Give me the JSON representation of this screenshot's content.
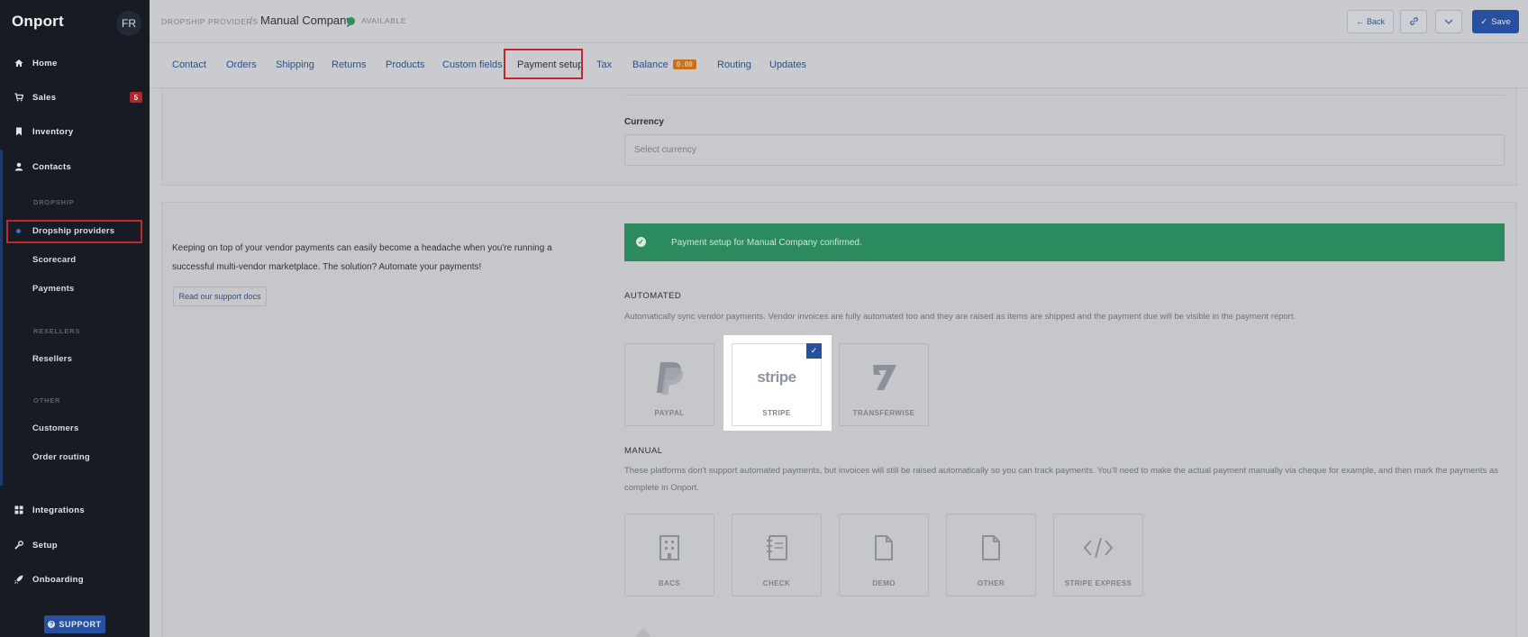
{
  "sidebar": {
    "logo": "Onport",
    "avatar": "FR",
    "nav": [
      {
        "label": "Home",
        "icon": "home-icon"
      },
      {
        "label": "Sales",
        "icon": "cart-icon",
        "badge": "5"
      },
      {
        "label": "Inventory",
        "icon": "bookmark-icon"
      },
      {
        "label": "Contacts",
        "icon": "user-icon"
      }
    ],
    "dropship_head": "DROPSHIP",
    "dropship_items": [
      "Dropship providers",
      "Scorecard",
      "Payments"
    ],
    "resellers_head": "RESELLERS",
    "resellers_items": [
      "Resellers"
    ],
    "other_head": "OTHER",
    "other_items": [
      "Customers",
      "Order routing"
    ],
    "bottom_nav": [
      {
        "label": "Integrations",
        "icon": "grid-icon"
      },
      {
        "label": "Setup",
        "icon": "wrench-icon"
      },
      {
        "label": "Onboarding",
        "icon": "rocket-icon"
      }
    ],
    "support": "SUPPORT"
  },
  "header": {
    "breadcrumb": "DROPSHIP PROVIDERS",
    "separator": "/",
    "title": "Manual Company",
    "status": "AVAILABLE",
    "status_color": "#2f8f5b",
    "back": "Back",
    "save": "Save"
  },
  "tabs": [
    "Contact",
    "Orders",
    "Shipping",
    "Returns",
    "Products",
    "Custom fields",
    "Payment setup",
    "Tax",
    "Balance",
    "Routing",
    "Updates"
  ],
  "balance_badge": "0.00",
  "currency": {
    "label": "Currency",
    "placeholder": "Select currency"
  },
  "payments": {
    "intro": "Keeping on top of your vendor payments can easily become a headache when you're running a successful multi-vendor marketplace. The solution? Automate your payments!",
    "docs_button": "Read our support docs",
    "alert": "Payment setup for Manual Company confirmed.",
    "alert_color": "#2b8a5e",
    "automated_title": "AUTOMATED",
    "automated_desc": "Automatically sync vendor payments. Vendor invoices are fully automated too and they are raised as items are shipped and the payment due will be visible in the payment report.",
    "automated": [
      {
        "label": "PAYPAL",
        "icon": "paypal-icon"
      },
      {
        "label": "STRIPE",
        "icon": "stripe-logo",
        "logo_text": "stripe",
        "selected": true
      },
      {
        "label": "TRANSFERWISE",
        "icon": "transferwise-icon"
      }
    ],
    "manual_title": "MANUAL",
    "manual_desc": "These platforms don't support automated payments, but invoices will still be raised automatically so you can track payments. You'll need to make the actual payment manually via cheque for example, and then mark the payments as complete in Onport.",
    "manual": [
      {
        "label": "BACS",
        "icon": "building-icon"
      },
      {
        "label": "CHECK",
        "icon": "notebook-icon"
      },
      {
        "label": "DEMO",
        "icon": "file-icon"
      },
      {
        "label": "OTHER",
        "icon": "file-icon"
      },
      {
        "label": "STRIPE EXPRESS",
        "icon": "code-icon"
      }
    ]
  },
  "accent_color": "#27509e",
  "highlight_color": "#c2262e"
}
